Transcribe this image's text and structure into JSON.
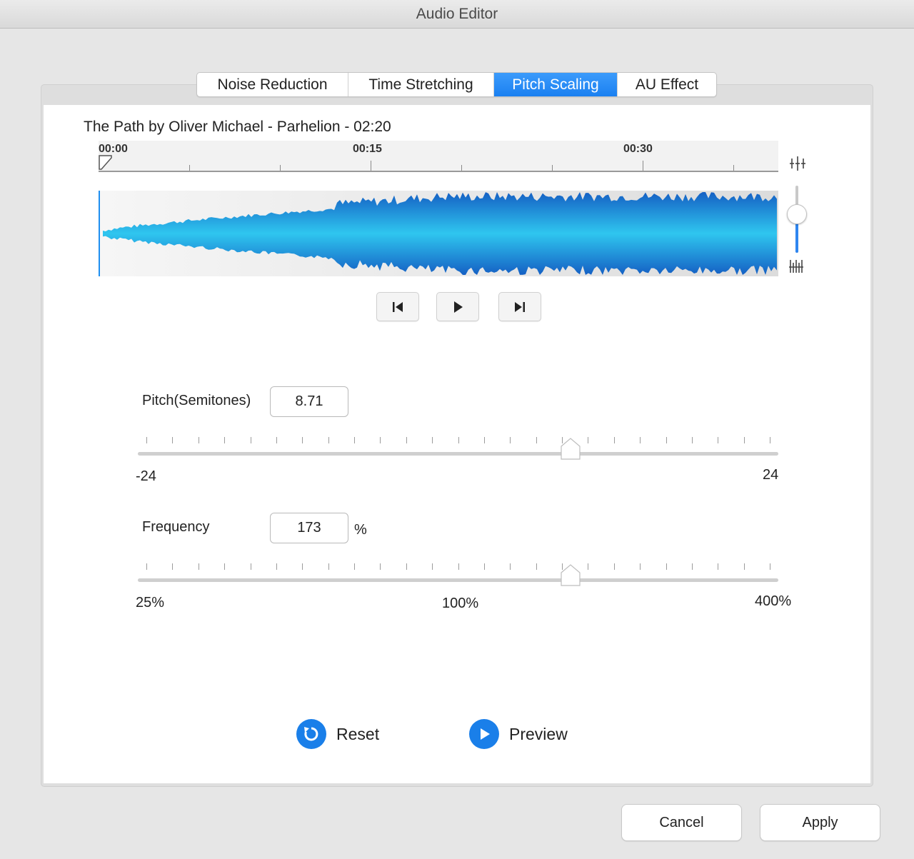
{
  "window": {
    "title": "Audio Editor"
  },
  "tabs": [
    {
      "label": "Noise Reduction",
      "active": false
    },
    {
      "label": "Time Stretching",
      "active": false
    },
    {
      "label": "Pitch Scaling",
      "active": true
    },
    {
      "label": "AU Effect",
      "active": false
    }
  ],
  "track": {
    "title": "The Path by Oliver Michael - Parhelion - 02:20"
  },
  "timeline": {
    "labels": [
      "00:00",
      "00:15",
      "00:30"
    ]
  },
  "transport": {
    "previous_icon": "skip-to-start-icon",
    "play_icon": "play-icon",
    "next_icon": "skip-to-end-icon"
  },
  "zoom": {
    "top_icon": "zoom-out-icon",
    "bottom_icon": "zoom-in-icon",
    "level": 0.57
  },
  "pitch": {
    "label": "Pitch(Semitones)",
    "value": "8.71",
    "min_label": "-24",
    "max_label": "24",
    "position": 0.676
  },
  "frequency": {
    "label": "Frequency",
    "value": "173",
    "unit": "%",
    "min_label": "25%",
    "mid_label": "100%",
    "max_label": "400%",
    "position": 0.676
  },
  "actions": {
    "reset_label": "Reset",
    "preview_label": "Preview"
  },
  "buttons": {
    "cancel_label": "Cancel",
    "apply_label": "Apply"
  },
  "colors": {
    "accent": "#1a7fe9",
    "tab_active": "#2a8cf6",
    "wave_edge": "#1863c8",
    "wave_center": "#2fc4ee"
  }
}
